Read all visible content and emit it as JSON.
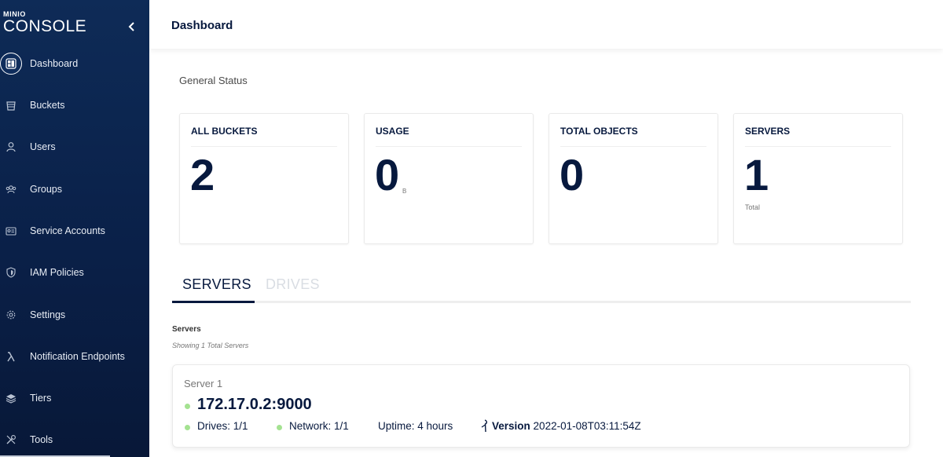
{
  "sidebar": {
    "logo_small": "MINIO",
    "logo_big": "CONSOLE",
    "items": [
      {
        "label": "Dashboard",
        "icon": "dashboard-icon",
        "active": true
      },
      {
        "label": "Buckets",
        "icon": "bucket-icon"
      },
      {
        "label": "Users",
        "icon": "user-icon"
      },
      {
        "label": "Groups",
        "icon": "groups-icon"
      },
      {
        "label": "Service Accounts",
        "icon": "id-card-icon"
      },
      {
        "label": "IAM Policies",
        "icon": "shield-icon"
      },
      {
        "label": "Settings",
        "icon": "gear-icon"
      },
      {
        "label": "Notification Endpoints",
        "icon": "lambda-icon"
      },
      {
        "label": "Tiers",
        "icon": "layers-icon"
      },
      {
        "label": "Tools",
        "icon": "tools-icon"
      }
    ]
  },
  "header": {
    "title": "Dashboard"
  },
  "main": {
    "section_title": "General Status",
    "cards": [
      {
        "title": "ALL BUCKETS",
        "value": "2"
      },
      {
        "title": "USAGE",
        "value": "0",
        "unit": "B"
      },
      {
        "title": "TOTAL OBJECTS",
        "value": "0"
      },
      {
        "title": "SERVERS",
        "value": "1",
        "sub": "Total"
      }
    ],
    "tabs": [
      {
        "label": "SERVERS",
        "active": true
      },
      {
        "label": "DRIVES",
        "active": false
      }
    ],
    "servers_title": "Servers",
    "servers_subtitle": "Showing 1 Total Servers",
    "server": {
      "name": "Server 1",
      "endpoint": "172.17.0.2:9000",
      "drives": "Drives: 1/1",
      "network": "Network: 1/1",
      "uptime": "Uptime: 4 hours",
      "version_label": "Version",
      "version_value": "2022-01-08T03:11:54Z"
    }
  },
  "colors": {
    "sidebar_bg": "#0a2048",
    "primary_text": "#07193e",
    "status_ok": "#a4e291",
    "tab_inactive": "#d9dde3"
  }
}
